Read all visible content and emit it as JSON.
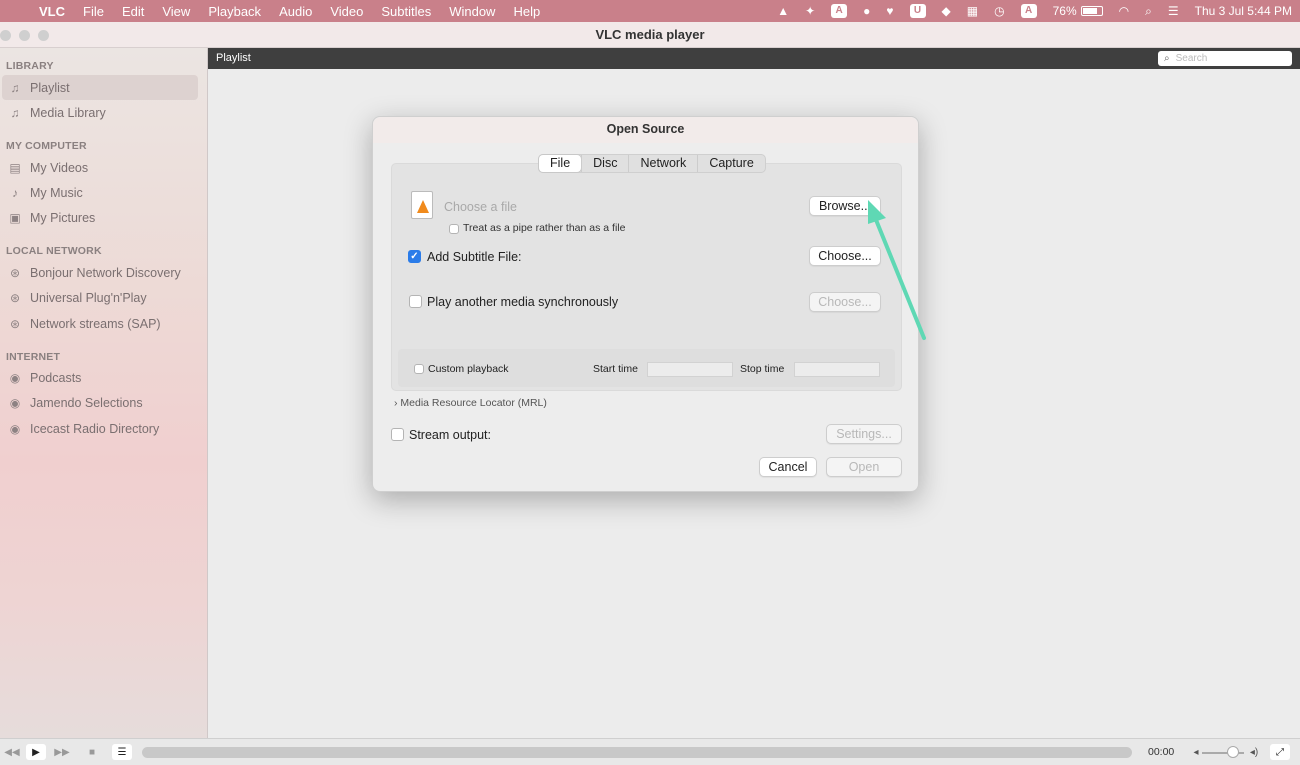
{
  "menubar": {
    "app": "VLC",
    "items": [
      "File",
      "Edit",
      "View",
      "Playback",
      "Audio",
      "Video",
      "Subtitles",
      "Window",
      "Help"
    ],
    "battery": "76%",
    "datetime": "Thu 3 Jul  5:44 PM"
  },
  "window": {
    "title": "VLC media player"
  },
  "sidebar": {
    "sections": [
      {
        "title": "LIBRARY",
        "items": [
          {
            "label": "Playlist",
            "icon": "playlist-icon"
          },
          {
            "label": "Media Library",
            "icon": "media-library-icon"
          }
        ]
      },
      {
        "title": "MY COMPUTER",
        "items": [
          {
            "label": "My Videos",
            "icon": "video-icon"
          },
          {
            "label": "My Music",
            "icon": "music-icon"
          },
          {
            "label": "My Pictures",
            "icon": "pictures-icon"
          }
        ]
      },
      {
        "title": "LOCAL NETWORK",
        "items": [
          {
            "label": "Bonjour Network Discovery",
            "icon": "network-icon"
          },
          {
            "label": "Universal Plug'n'Play",
            "icon": "network-icon"
          },
          {
            "label": "Network streams (SAP)",
            "icon": "network-icon"
          }
        ]
      },
      {
        "title": "INTERNET",
        "items": [
          {
            "label": "Podcasts",
            "icon": "podcast-icon"
          },
          {
            "label": "Jamendo Selections",
            "icon": "podcast-icon"
          },
          {
            "label": "Icecast Radio Directory",
            "icon": "podcast-icon"
          }
        ]
      }
    ]
  },
  "playlist_bar": {
    "label": "Playlist",
    "search_placeholder": "Search"
  },
  "dialog": {
    "title": "Open Source",
    "tabs": [
      "File",
      "Disc",
      "Network",
      "Capture"
    ],
    "choose_file": "Choose a file",
    "browse": "Browse...",
    "pipe_label": "Treat as a pipe rather than as a file",
    "subtitle_label": "Add Subtitle File:",
    "choose_label": "Choose...",
    "sync_label": "Play another media synchronously",
    "choose_disabled": "Choose...",
    "custom_playback": "Custom playback",
    "start_time": "Start time",
    "stop_time": "Stop time",
    "mrl": "Media Resource Locator (MRL)",
    "stream_output": "Stream output:",
    "settings": "Settings...",
    "cancel": "Cancel",
    "open": "Open"
  },
  "bottom": {
    "time": "00:00"
  },
  "colors": {
    "arrow": "#5fd8b4",
    "checkbox": "#2b7ce9",
    "menubar": "#c9808a"
  }
}
